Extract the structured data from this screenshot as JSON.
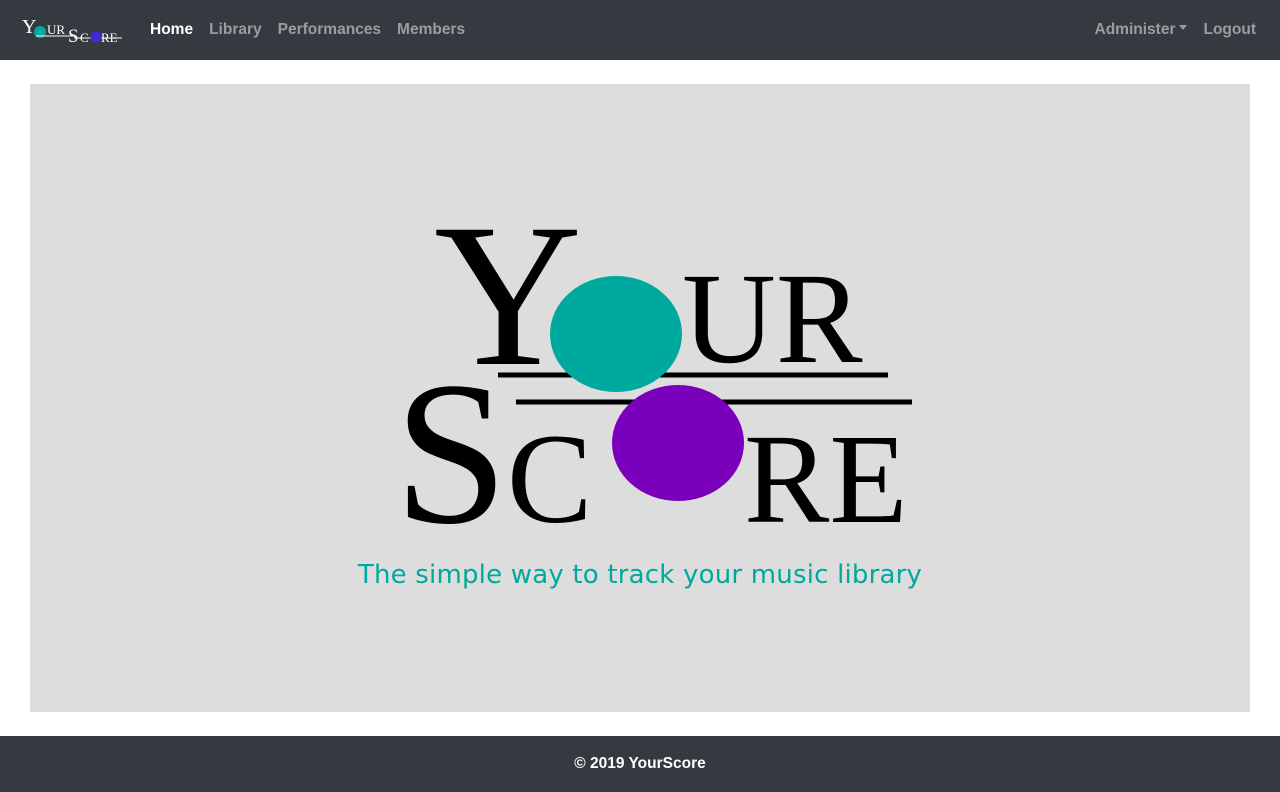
{
  "brand": {
    "logo_name": "YourScore",
    "logo_letters": {
      "y": "Y",
      "our": "UR",
      "s": "S",
      "c": "C",
      "re": "RE"
    }
  },
  "nav": {
    "items": [
      {
        "label": "Home",
        "active": true
      },
      {
        "label": "Library",
        "active": false
      },
      {
        "label": "Performances",
        "active": false
      },
      {
        "label": "Members",
        "active": false
      }
    ],
    "administer_label": "Administer",
    "logout_label": "Logout"
  },
  "hero": {
    "logo_letters": {
      "y": "Y",
      "our": "UR",
      "s": "S",
      "c": "C",
      "re": "RE"
    },
    "tagline": "The simple way to track your music library"
  },
  "footer": {
    "text": "© 2019 YourScore"
  },
  "colors": {
    "navbar_bg": "#343a40",
    "hero_bg": "#dddddd",
    "accent_teal": "#00a99d",
    "accent_purple": "#7b00bc",
    "brand_purple": "#3b2fd1"
  }
}
